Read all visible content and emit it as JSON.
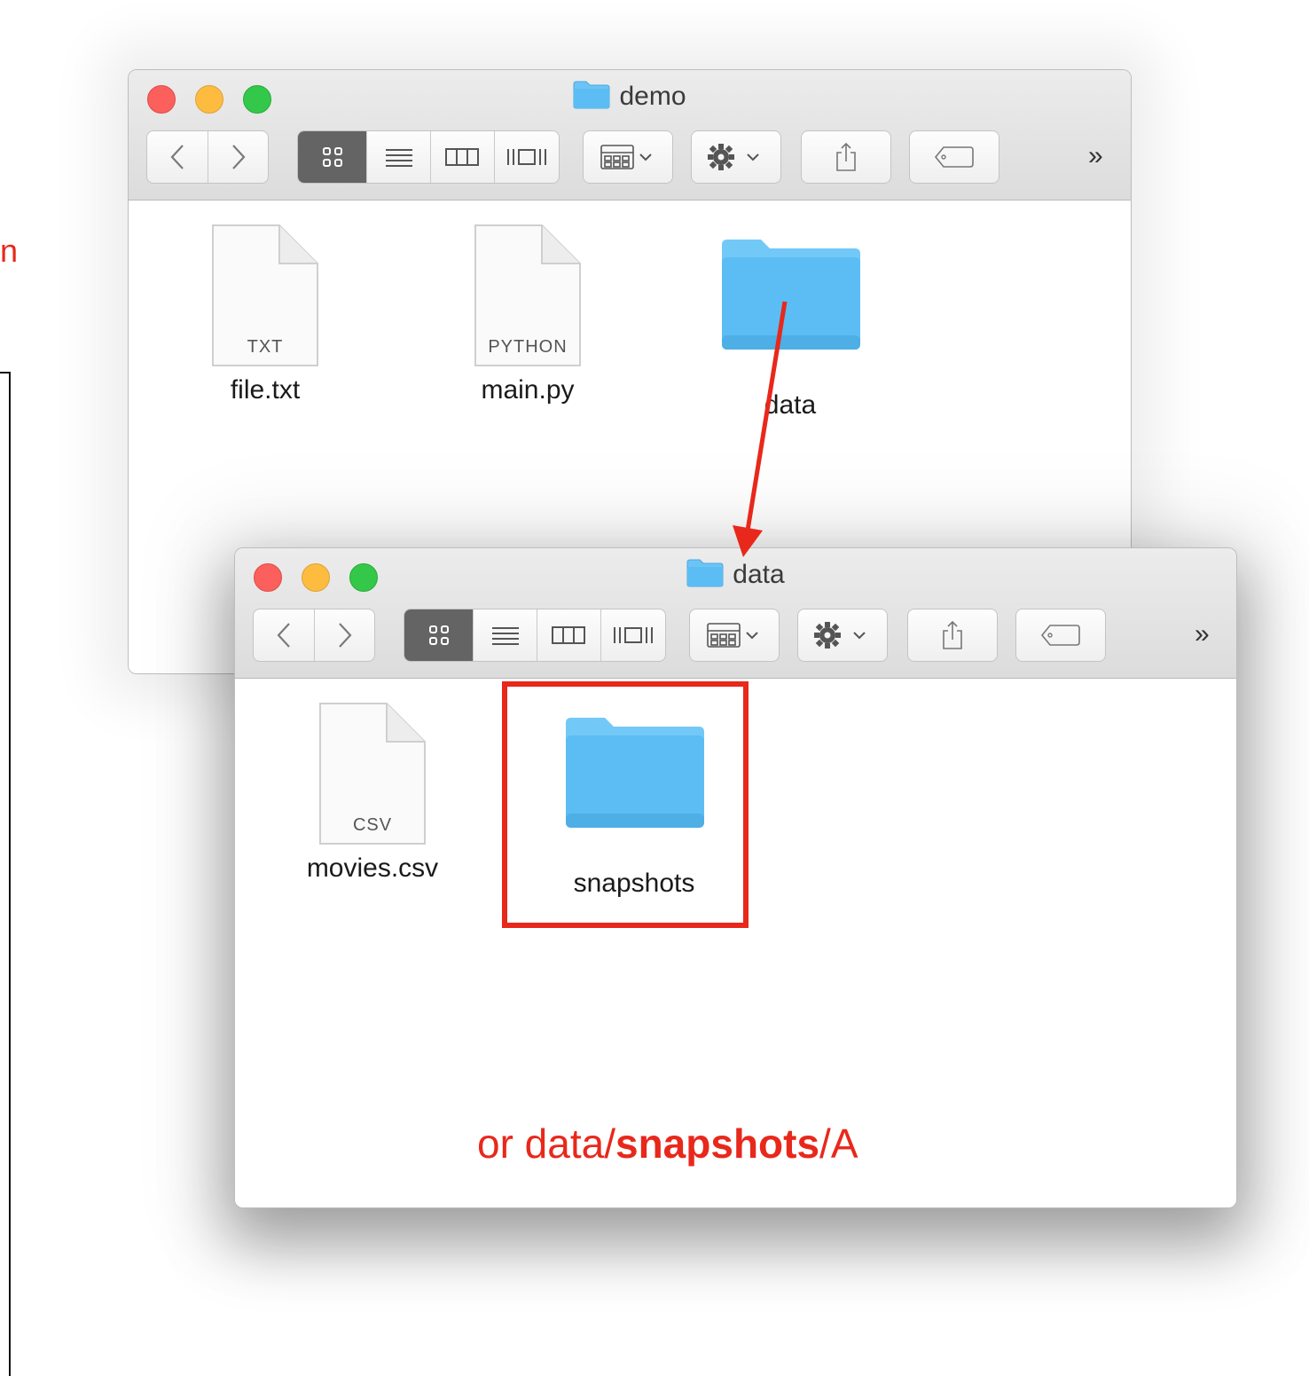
{
  "edge_note": {
    "glyph": "n"
  },
  "windows": [
    {
      "id": "back",
      "title": "demo",
      "items": [
        {
          "name": "file.txt",
          "kind": "document",
          "ext": "TXT"
        },
        {
          "name": "main.py",
          "kind": "document",
          "ext": "PYTHON"
        },
        {
          "name": "data",
          "kind": "folder"
        }
      ]
    },
    {
      "id": "front",
      "title": "data",
      "items": [
        {
          "name": "movies.csv",
          "kind": "document",
          "ext": "CSV"
        },
        {
          "name": "snapshots",
          "kind": "folder"
        }
      ]
    }
  ],
  "toolbar": {
    "more_label": "»"
  },
  "annotation": {
    "prefix": "or data/",
    "bold": "snapshots",
    "suffix": "/A",
    "color": "#e8281b"
  },
  "colors": {
    "folder": "#5bbdf4",
    "folder_tab": "#72c9f7",
    "accent_red": "#e8281b"
  }
}
